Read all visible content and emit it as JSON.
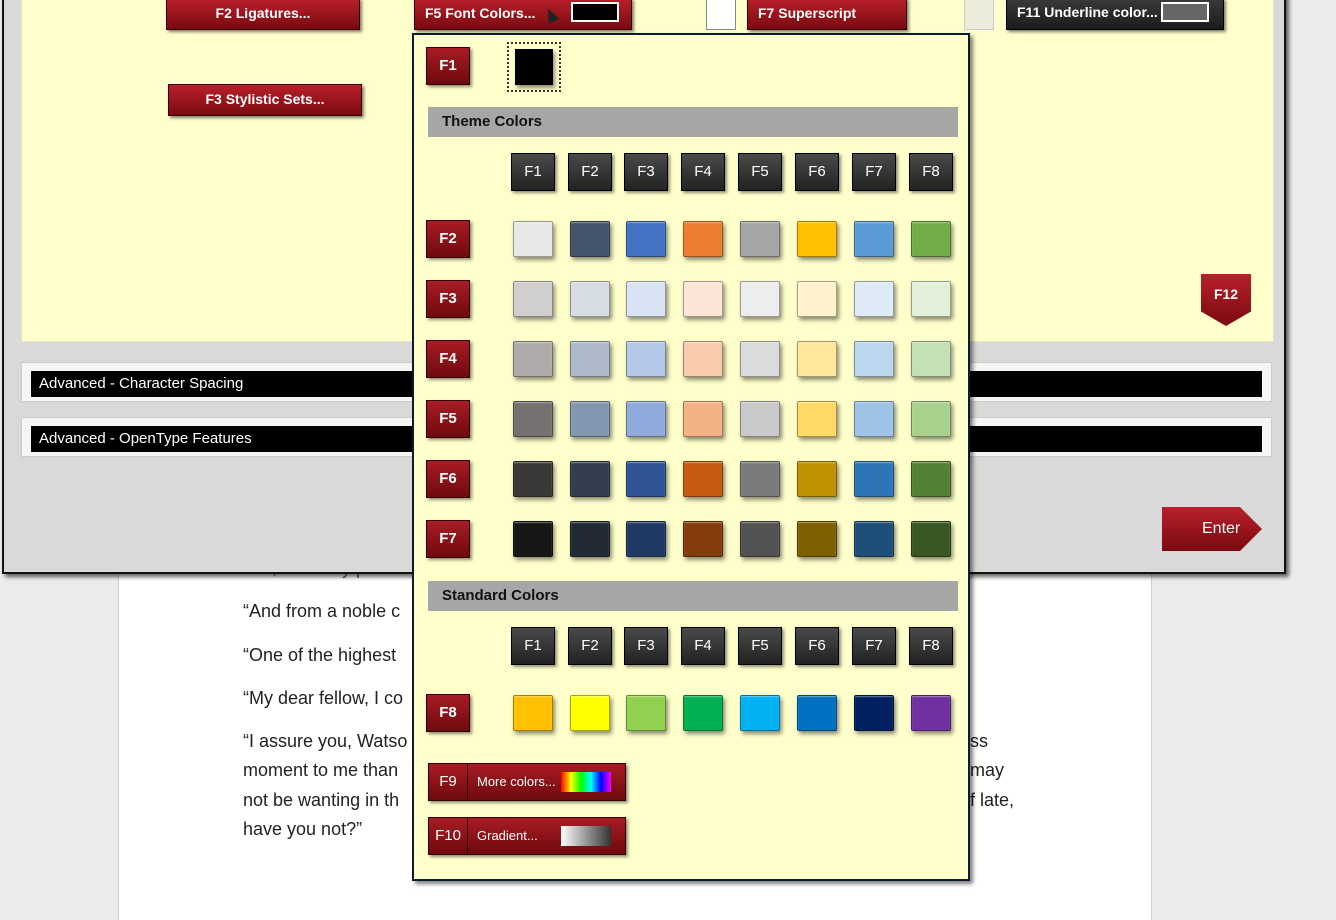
{
  "document": {
    "lines": [
      "“No, distinctly prote",
      "“And from a noble c",
      "“One of the highest",
      "“My dear fellow, I co",
      "“I assure you, Watso",
      "moment to me than",
      "not be wanting in th",
      "have you not?”"
    ],
    "right_fragments": [
      "ss",
      "may",
      "f late,"
    ]
  },
  "dialog": {
    "buttons": {
      "f2_ligatures": "F2 Ligatures...",
      "f3_stylistic": "F3 Stylistic Sets...",
      "f5_font_colors": "F5 Font Colors...",
      "f7_superscript": "F7 Superscript",
      "f11_underline": "F11 Underline color...",
      "f12": "F12",
      "enter": "Enter"
    },
    "advanced_spacing": "Advanced - Character Spacing",
    "advanced_opentype": "Advanced - OpenType Features",
    "current_font_color": "#000000",
    "current_underline_color": "#666666"
  },
  "popup": {
    "auto_key": "F1",
    "auto_color": "#000000",
    "theme_header": "Theme Colors",
    "standard_header": "Standard Colors",
    "column_keys": [
      "F1",
      "F2",
      "F3",
      "F4",
      "F5",
      "F6",
      "F7",
      "F8"
    ],
    "theme_rows": [
      {
        "key": "F2",
        "colors": [
          "#e8e8e8",
          "#44546a",
          "#4472c4",
          "#ed7d31",
          "#a5a5a5",
          "#ffc000",
          "#5b9bd5",
          "#70ad47"
        ]
      },
      {
        "key": "F3",
        "colors": [
          "#d0cece",
          "#d6dce4",
          "#d9e2f3",
          "#fbe5d6",
          "#ededed",
          "#fff2cc",
          "#deebf7",
          "#e2f0d9"
        ]
      },
      {
        "key": "F4",
        "colors": [
          "#aeaaaa",
          "#adb9ca",
          "#b4c7e7",
          "#f8cbad",
          "#dbdbdb",
          "#ffe699",
          "#bdd7ee",
          "#c5e0b4"
        ]
      },
      {
        "key": "F5",
        "colors": [
          "#767171",
          "#8497b0",
          "#8faadc",
          "#f4b183",
          "#c9c9c9",
          "#ffd966",
          "#9dc3e6",
          "#a9d18e"
        ]
      },
      {
        "key": "F6",
        "colors": [
          "#3b3838",
          "#333f50",
          "#2f5597",
          "#c55a11",
          "#7b7b7b",
          "#bf9000",
          "#2e75b6",
          "#538135"
        ]
      },
      {
        "key": "F7",
        "colors": [
          "#181717",
          "#222a35",
          "#1f3864",
          "#843c0c",
          "#525252",
          "#7f6000",
          "#1f4e79",
          "#385723"
        ]
      }
    ],
    "standard_row": {
      "key": "F8",
      "colors": [
        "#ffc000",
        "#ffff00",
        "#92d050",
        "#00b050",
        "#00b0f0",
        "#0070c0",
        "#002060",
        "#7030a0"
      ]
    },
    "more_colors": {
      "key": "F9",
      "label": "More colors..."
    },
    "gradient": {
      "key": "F10",
      "label": "Gradient..."
    }
  }
}
